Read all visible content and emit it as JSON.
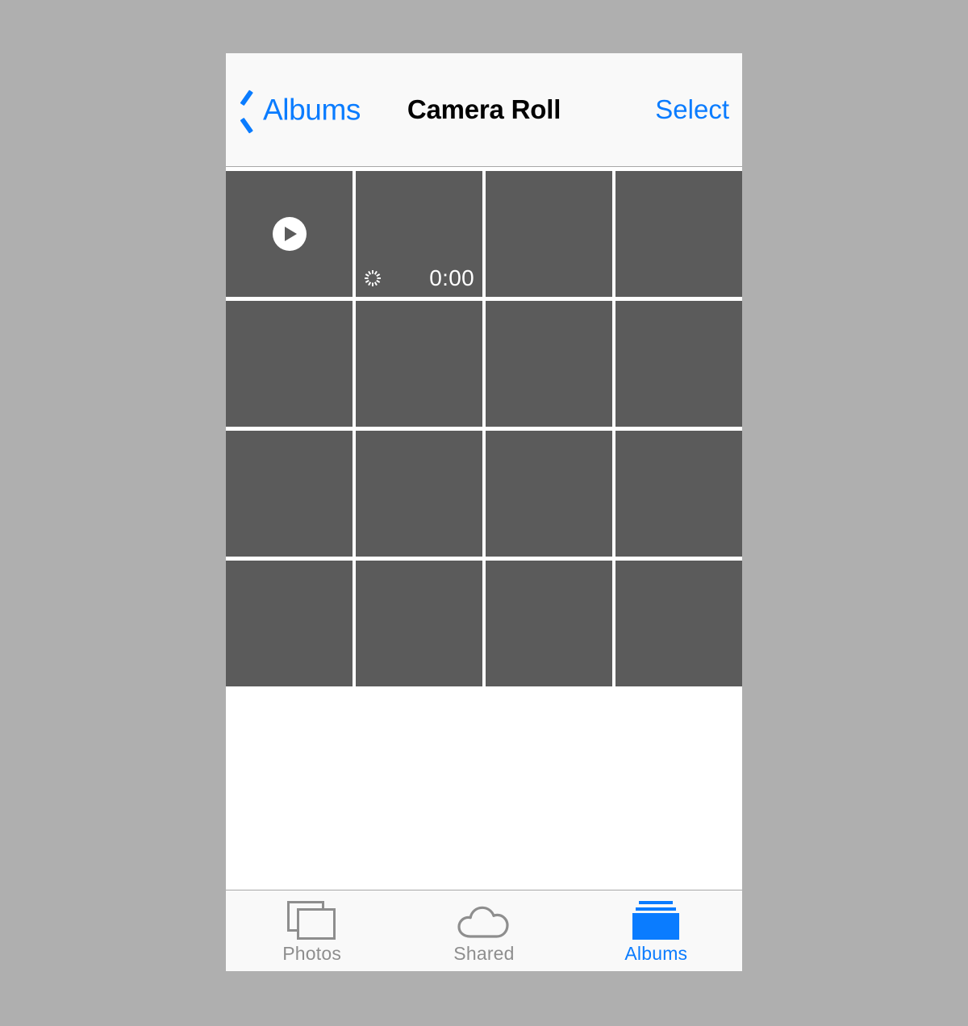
{
  "theme": {
    "accent": "#0a7cff",
    "page_background": "#afafaf",
    "bar_background": "#f9f9f9",
    "thumbnail_gray": "#5b5b5b",
    "inactive_tab": "#8e8e8e"
  },
  "nav": {
    "back_label": "Albums",
    "back_icon": "chevron-left-icon",
    "title": "Camera Roll",
    "action_label": "Select"
  },
  "grid": {
    "columns": 4,
    "items": [
      {
        "id": "item-1",
        "type": "video",
        "badge_icon": "play-icon",
        "duration": null,
        "loading": false
      },
      {
        "id": "item-2",
        "type": "video",
        "badge_icon": null,
        "duration": "0:00",
        "loading": true,
        "spinner_icon": "activity-spinner-icon"
      },
      {
        "id": "item-3",
        "type": "photo",
        "badge_icon": null,
        "duration": null,
        "loading": false
      },
      {
        "id": "item-4",
        "type": "photo",
        "badge_icon": null,
        "duration": null,
        "loading": false
      },
      {
        "id": "item-5",
        "type": "photo",
        "badge_icon": null,
        "duration": null,
        "loading": false
      },
      {
        "id": "item-6",
        "type": "photo",
        "badge_icon": null,
        "duration": null,
        "loading": false
      },
      {
        "id": "item-7",
        "type": "photo",
        "badge_icon": null,
        "duration": null,
        "loading": false
      },
      {
        "id": "item-8",
        "type": "photo",
        "badge_icon": null,
        "duration": null,
        "loading": false
      },
      {
        "id": "item-9",
        "type": "photo",
        "badge_icon": null,
        "duration": null,
        "loading": false
      },
      {
        "id": "item-10",
        "type": "photo",
        "badge_icon": null,
        "duration": null,
        "loading": false
      },
      {
        "id": "item-11",
        "type": "photo",
        "badge_icon": null,
        "duration": null,
        "loading": false
      },
      {
        "id": "item-12",
        "type": "photo",
        "badge_icon": null,
        "duration": null,
        "loading": false
      },
      {
        "id": "item-13",
        "type": "photo",
        "badge_icon": null,
        "duration": null,
        "loading": false
      },
      {
        "id": "item-14",
        "type": "photo",
        "badge_icon": null,
        "duration": null,
        "loading": false
      },
      {
        "id": "item-15",
        "type": "photo",
        "badge_icon": null,
        "duration": null,
        "loading": false
      },
      {
        "id": "item-16",
        "type": "photo",
        "badge_icon": null,
        "duration": null,
        "loading": false
      }
    ]
  },
  "tabs": [
    {
      "label": "Photos",
      "icon": "photos-stack-icon",
      "active": false
    },
    {
      "label": "Shared",
      "icon": "cloud-icon",
      "active": false
    },
    {
      "label": "Albums",
      "icon": "albums-stack-icon",
      "active": true
    }
  ]
}
